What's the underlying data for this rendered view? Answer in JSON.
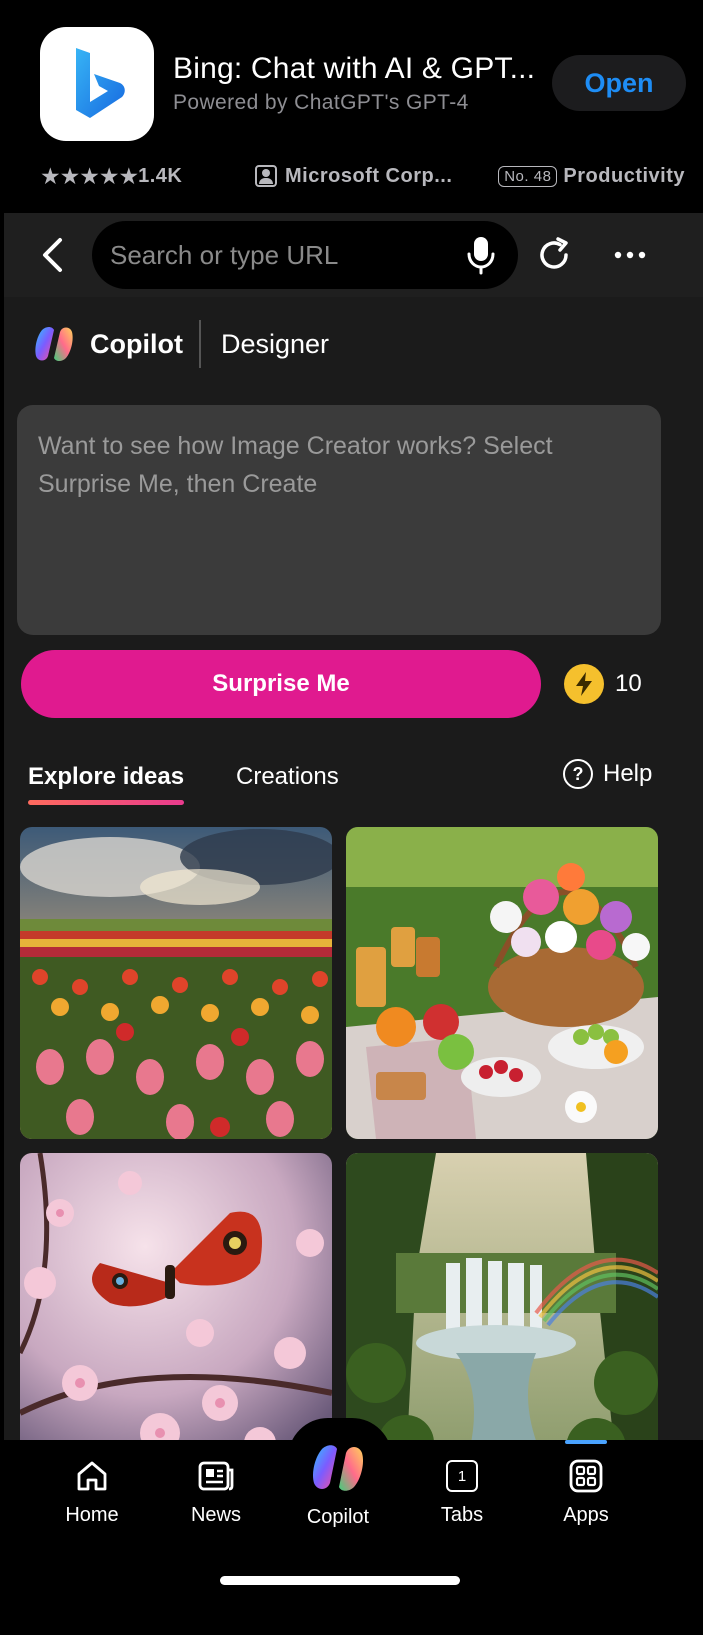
{
  "banner": {
    "app_title": "Bing: Chat with AI & GPT...",
    "app_subtitle": "Powered by ChatGPT's GPT-4",
    "open_label": "Open",
    "rating_stars": 5,
    "rating_count": "1.4K",
    "developer": "Microsoft Corp...",
    "rank": "No. 48",
    "category": "Productivity",
    "open_color": "#1e8df5"
  },
  "browser": {
    "search_placeholder": "Search or type URL"
  },
  "header": {
    "brand": "Copilot",
    "product": "Designer"
  },
  "prompt": {
    "placeholder": "Want to see how Image Creator works? Select Surprise Me, then Create"
  },
  "actions": {
    "surprise_label": "Surprise Me",
    "boost_count": "10",
    "accent": "#e01a8f"
  },
  "tabs": {
    "explore": "Explore ideas",
    "creations": "Creations",
    "help": "Help"
  },
  "gallery": [
    {
      "subject": "tulip field under dramatic sky"
    },
    {
      "subject": "picnic basket with flowers and fruit"
    },
    {
      "subject": "butterfly on cherry blossoms"
    },
    {
      "subject": "jungle waterfall with rainbow"
    }
  ],
  "nav": {
    "home": "Home",
    "news": "News",
    "copilot": "Copilot",
    "tabs": "Tabs",
    "tabs_count": "1",
    "apps": "Apps"
  }
}
